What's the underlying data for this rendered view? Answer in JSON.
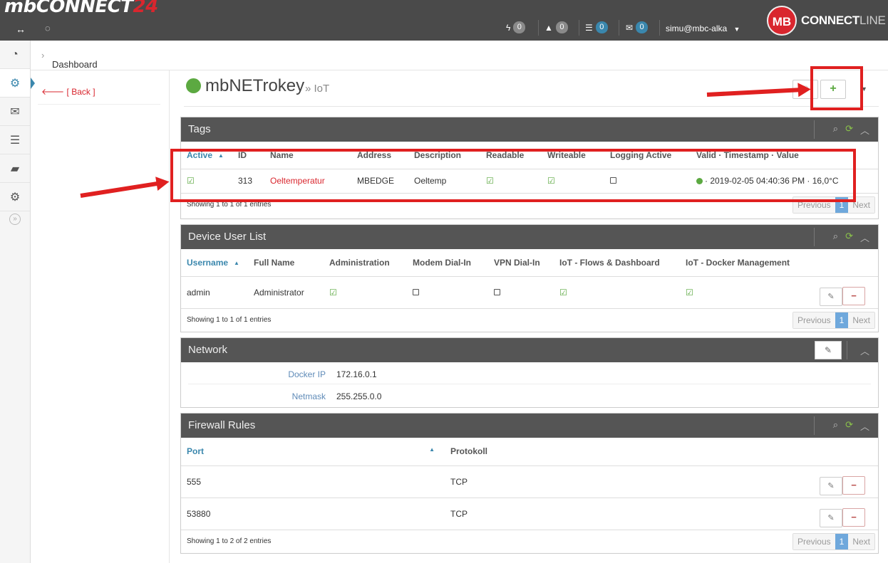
{
  "topbar": {
    "logo_main": "mbCONNECT",
    "logo_num": "24",
    "power_count": "0",
    "alert_count": "0",
    "server_count": "0",
    "mail_count": "0",
    "user": "simu@mbc-alka",
    "brand_mb": "MB",
    "brand_connect": "CONNECT",
    "brand_line": "LINE"
  },
  "breadcrumb": {
    "dashboard": "Dashboard",
    "sep": "›"
  },
  "subnav": {
    "back": "[ Back ]"
  },
  "page": {
    "title": "mbNETrokey",
    "subtitle": "» IoT",
    "add_button": "+"
  },
  "tags": {
    "title": "Tags",
    "headers": [
      "Active",
      "ID",
      "Name",
      "Address",
      "Description",
      "Readable",
      "Writeable",
      "Logging Active",
      "Valid · Timestamp · Value"
    ],
    "row": {
      "id": "313",
      "name": "Oeltemperatur",
      "address": "MBEDGE",
      "description": "Oeltemp",
      "value": "· 2019-02-05 04:40:36 PM · 16,0°C"
    },
    "info": "Showing 1 to 1 of 1 entries"
  },
  "users": {
    "title": "Device User List",
    "headers": [
      "Username",
      "Full Name",
      "Administration",
      "Modem Dial-In",
      "VPN Dial-In",
      "IoT - Flows & Dashboard",
      "IoT - Docker Management"
    ],
    "row": {
      "username": "admin",
      "fullname": "Administrator"
    },
    "info": "Showing 1 to 1 of 1 entries"
  },
  "network": {
    "title": "Network",
    "docker_ip_label": "Docker IP",
    "docker_ip": "172.16.0.1",
    "netmask_label": "Netmask",
    "netmask": "255.255.0.0"
  },
  "firewall": {
    "title": "Firewall Rules",
    "headers": [
      "Port",
      "Protokoll"
    ],
    "rows": [
      {
        "port": "555",
        "proto": "TCP"
      },
      {
        "port": "53880",
        "proto": "TCP"
      }
    ],
    "info": "Showing 1 to 2 of 2 entries"
  },
  "pager": {
    "previous": "Previous",
    "page": "1",
    "next": "Next"
  },
  "colors": {
    "accent": "#3a87ad",
    "brand_red": "#d9262e",
    "ok_green": "#5ca941",
    "annotation_red": "#e02020"
  }
}
